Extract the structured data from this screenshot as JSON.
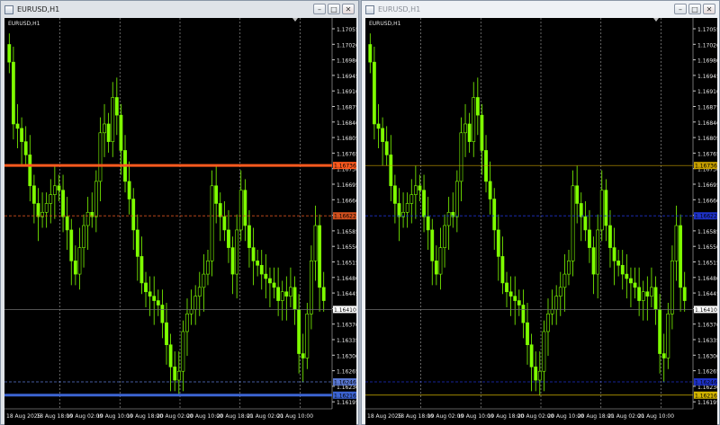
{
  "windows": [
    {
      "title": "EURUSD,H1",
      "symbol_label": "EURUSD,H1",
      "buttons": {
        "minimize": "–",
        "maximize": "□",
        "close": "✕"
      }
    },
    {
      "title": "EURUSD,H1",
      "symbol_label": "EURUSD,H1",
      "buttons": {
        "minimize": "–",
        "maximize": "□",
        "close": "✕"
      }
    }
  ],
  "colors": {
    "background": "#000000",
    "candle": "#7fff00",
    "grid": "#c8c8c8",
    "left_hlines": [
      "#ff5a1e",
      "#d2501e",
      "#6e6e6e",
      "#5a78d2",
      "#3c64d2"
    ],
    "right_hlines": [
      "#c8a000",
      "#1e32c8",
      "#6e6e6e",
      "#1e32c8",
      "#d2b400"
    ]
  },
  "chart_data": [
    {
      "type": "candlestick",
      "symbol": "EURUSD",
      "timeframe": "H1",
      "ylim": [
        1.16185,
        1.1707
      ],
      "y_ticks": [
        "1.17055",
        "1.17020",
        "1.16980",
        "1.16945",
        "1.16910",
        "1.16875",
        "1.16840",
        "1.16805",
        "1.16765",
        "1.16730",
        "1.16695",
        "1.16660",
        "1.16620",
        "1.16585",
        "1.16550",
        "1.16515",
        "1.16480",
        "1.16445",
        "1.16410",
        "1.16370",
        "1.16335",
        "1.16300",
        "1.16265",
        "1.16230",
        "1.16195"
      ],
      "x_labels": [
        "18 Aug 2025",
        "18 Aug 18:00",
        "19 Aug 02:00",
        "19 Aug 10:00",
        "19 Aug 18:00",
        "20 Aug 02:00",
        "20 Aug 10:00",
        "20 Aug 18:00",
        "21 Aug 02:00",
        "21 Aug 10:00"
      ],
      "hlines": [
        {
          "price": 1.16736,
          "label": "1.16736",
          "style": "solid-thick"
        },
        {
          "price": 1.16622,
          "label": "1.16622",
          "style": "dashed"
        },
        {
          "price": 1.1641,
          "label": "1.16410",
          "style": "solid-thin"
        },
        {
          "price": 1.16246,
          "label": "1.16246",
          "style": "dashed"
        },
        {
          "price": 1.16216,
          "label": "1.16216",
          "style": "solid-thick"
        }
      ],
      "close_values": [
        1.1697,
        1.1683,
        1.1682,
        1.1679,
        1.1676,
        1.1669,
        1.1665,
        1.1662,
        1.1663,
        1.1665,
        1.1667,
        1.1669,
        1.1668,
        1.1662,
        1.1659,
        1.1652,
        1.1649,
        1.1655,
        1.166,
        1.1663,
        1.1662,
        1.167,
        1.1681,
        1.1683,
        1.1679,
        1.1689,
        1.1685,
        1.1677,
        1.167,
        1.1666,
        1.1659,
        1.1653,
        1.1647,
        1.1645,
        1.1644,
        1.1643,
        1.1642,
        1.1638,
        1.1633,
        1.1628,
        1.1625,
        1.1627,
        1.1636,
        1.164,
        1.1641,
        1.1644,
        1.1646,
        1.1649,
        1.1652,
        1.1669,
        1.1665,
        1.1662,
        1.1659,
        1.1655,
        1.1649,
        1.1659,
        1.1668,
        1.166,
        1.1655,
        1.1652,
        1.1651,
        1.1649,
        1.1648,
        1.1647,
        1.1646,
        1.1643,
        1.1645,
        1.1644,
        1.1646,
        1.1641,
        1.1631,
        1.163,
        1.164,
        1.1652,
        1.166,
        1.1646,
        1.1643
      ]
    },
    {
      "type": "candlestick",
      "symbol": "EURUSD",
      "timeframe": "H1",
      "ylim": [
        1.16185,
        1.1707
      ],
      "y_ticks": [
        "1.17055",
        "1.17020",
        "1.16980",
        "1.16945",
        "1.16910",
        "1.16875",
        "1.16840",
        "1.16805",
        "1.16765",
        "1.16730",
        "1.16695",
        "1.16660",
        "1.16620",
        "1.16585",
        "1.16550",
        "1.16515",
        "1.16480",
        "1.16445",
        "1.16410",
        "1.16370",
        "1.16335",
        "1.16300",
        "1.16265",
        "1.16230",
        "1.16195"
      ],
      "x_labels": [
        "18 Aug 2025",
        "18 Aug 18:00",
        "19 Aug 02:00",
        "19 Aug 10:00",
        "19 Aug 18:00",
        "20 Aug 02:00",
        "20 Aug 10:00",
        "20 Aug 18:00",
        "21 Aug 02:00",
        "21 Aug 10:00"
      ],
      "hlines": [
        {
          "price": 1.16736,
          "label": "1.16736",
          "style": "solid-thin"
        },
        {
          "price": 1.16622,
          "label": "1.16622",
          "style": "dashed"
        },
        {
          "price": 1.1641,
          "label": "1.16410",
          "style": "solid-thin"
        },
        {
          "price": 1.16246,
          "label": "1.16246",
          "style": "dashed"
        },
        {
          "price": 1.16216,
          "label": "1.16216",
          "style": "solid-thin"
        }
      ],
      "close_values": [
        1.1697,
        1.1683,
        1.1682,
        1.1679,
        1.1676,
        1.1669,
        1.1665,
        1.1662,
        1.1663,
        1.1665,
        1.1667,
        1.1669,
        1.1668,
        1.1662,
        1.1659,
        1.1652,
        1.1649,
        1.1655,
        1.166,
        1.1663,
        1.1662,
        1.167,
        1.1681,
        1.1683,
        1.1679,
        1.1689,
        1.1685,
        1.1677,
        1.167,
        1.1666,
        1.1659,
        1.1653,
        1.1647,
        1.1645,
        1.1644,
        1.1643,
        1.1642,
        1.1638,
        1.1633,
        1.1628,
        1.1625,
        1.1627,
        1.1636,
        1.164,
        1.1641,
        1.1644,
        1.1646,
        1.1649,
        1.1652,
        1.1669,
        1.1665,
        1.1662,
        1.1659,
        1.1655,
        1.1649,
        1.1659,
        1.1668,
        1.166,
        1.1655,
        1.1652,
        1.1651,
        1.1649,
        1.1648,
        1.1647,
        1.1646,
        1.1643,
        1.1645,
        1.1644,
        1.1646,
        1.1641,
        1.1631,
        1.163,
        1.164,
        1.1652,
        1.166,
        1.1646,
        1.1643
      ]
    }
  ]
}
